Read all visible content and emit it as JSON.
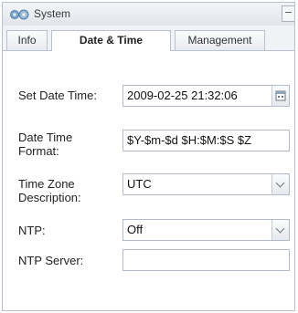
{
  "window": {
    "title": "System",
    "collapse_glyph": "−"
  },
  "tabs": [
    {
      "label": "Info",
      "active": false
    },
    {
      "label": "Date & Time",
      "active": true
    },
    {
      "label": "Management",
      "active": false
    }
  ],
  "form": {
    "set_date_time": {
      "label": "Set Date Time:",
      "value": "2009-02-25 21:32:06",
      "icon": "calendar-icon"
    },
    "date_time_format": {
      "label": "Date Time Format:",
      "value": "$Y-$m-$d $H:$M:$S $Z"
    },
    "time_zone": {
      "label": "Time Zone Description:",
      "value": "UTC"
    },
    "ntp": {
      "label": "NTP:",
      "value": "Off"
    },
    "ntp_server": {
      "label": "NTP Server:",
      "value": ""
    }
  },
  "colors": {
    "border": "#b9c2cc",
    "titlebar": "#e1e5ea"
  }
}
